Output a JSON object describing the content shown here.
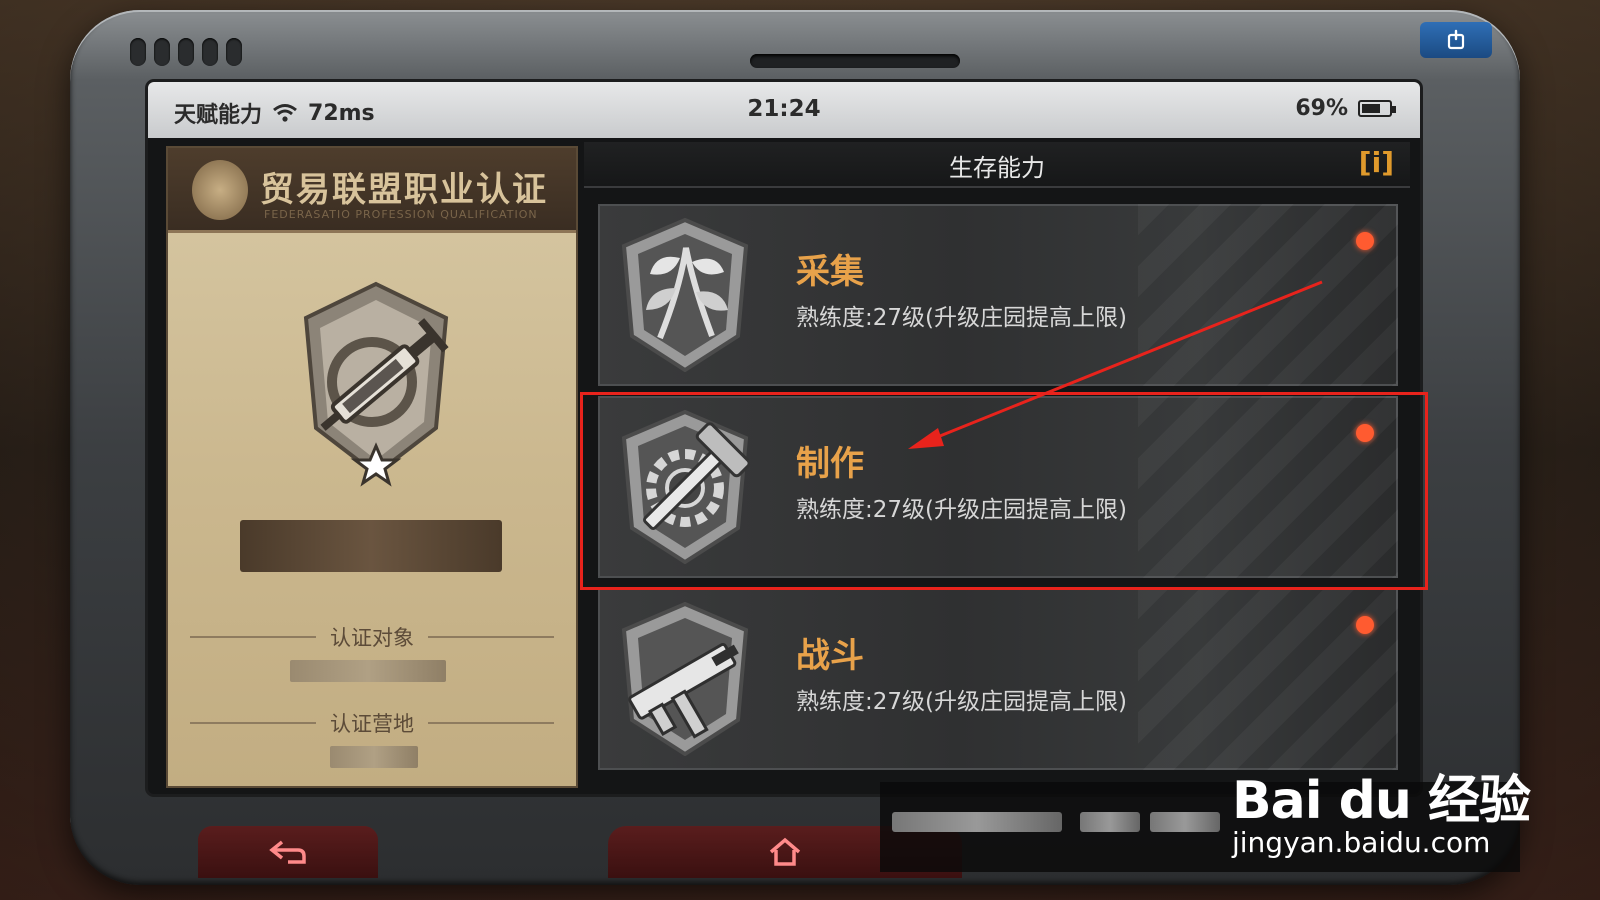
{
  "status_bar": {
    "app_label": "天赋能力",
    "ping": "72ms",
    "time": "21:24",
    "battery_text": "69%",
    "battery_level": 0.69
  },
  "certificate": {
    "title": "贸易联盟职业认证",
    "subtitle": "FEDERASATIO PROFESSION QUALIFICATION",
    "subject_label": "认证对象",
    "camp_label": "认证营地"
  },
  "panel": {
    "title": "生存能力",
    "info_label": "[i]"
  },
  "skills": [
    {
      "name": "采集",
      "desc": "熟练度:27级(升级庄园提高上限)",
      "icon": "herb-bundle-icon"
    },
    {
      "name": "制作",
      "desc": "熟练度:27级(升级庄园提高上限)",
      "icon": "hammer-gear-icon"
    },
    {
      "name": "战斗",
      "desc": "熟练度:27级(升级庄园提高上限)",
      "icon": "submachine-gun-icon"
    }
  ],
  "colors": {
    "accent_orange": "#e8a24a",
    "notification_red": "#ff5b30",
    "annotation_red": "#e8231c",
    "power_blue": "#2f6fb6"
  },
  "watermark": {
    "logo": "Bai du 经验",
    "url": "jingyan.baidu.com"
  }
}
